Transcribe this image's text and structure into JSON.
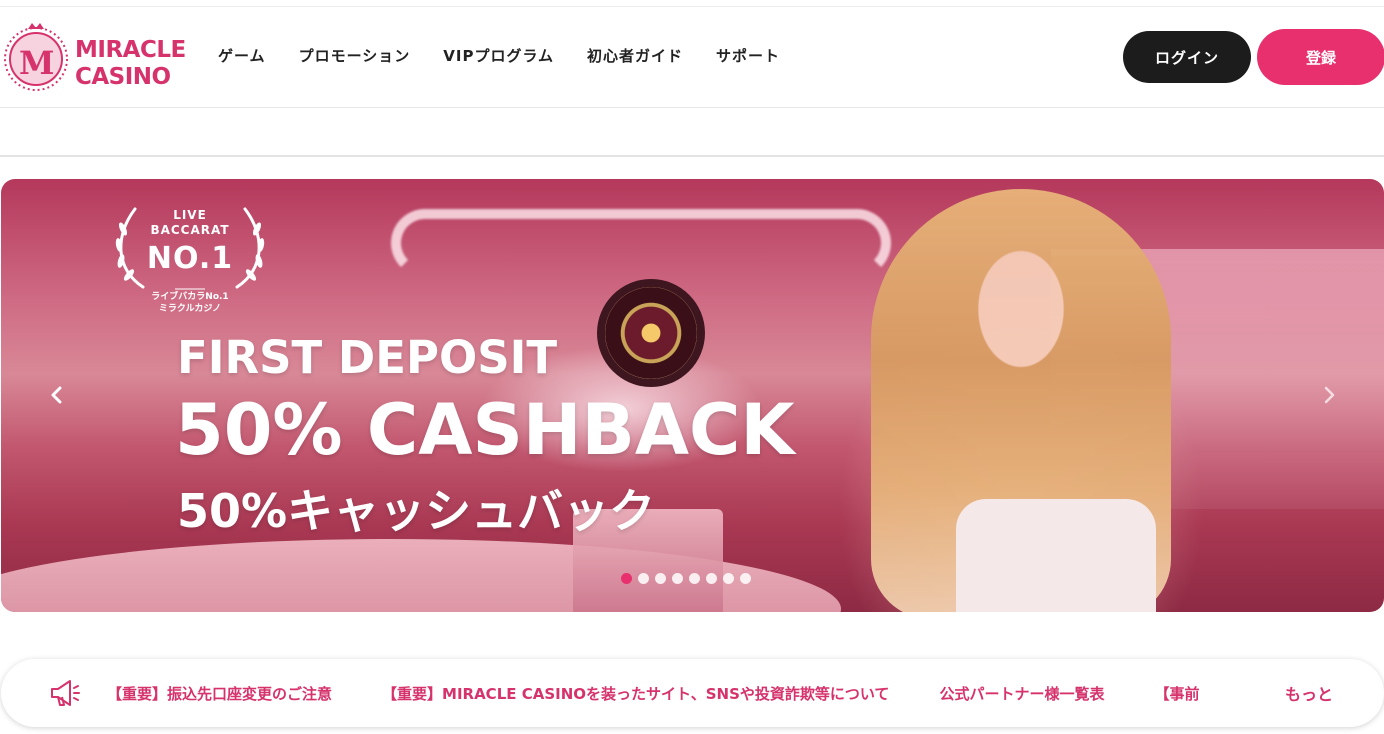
{
  "brand": {
    "logo_letter": "M",
    "logo_line1": "MIRACLE",
    "logo_line2": "CASINO",
    "accent_color": "#e7306d"
  },
  "nav": {
    "items": [
      "ゲーム",
      "プロモーション",
      "VIPプログラム",
      "初心者ガイド",
      "サポート"
    ]
  },
  "auth": {
    "login_label": "ログイン",
    "register_label": "登録"
  },
  "banner": {
    "badge_line1": "LIVE",
    "badge_line2": "BACCARAT",
    "badge_rank": "NO.1",
    "badge_jp1": "ライブバカラNo.1",
    "badge_jp2": "ミラクルカジノ",
    "line1": "FIRST DEPOSIT",
    "line2": "50% CASHBACK",
    "line3": "50%キャッシュバック",
    "prev_icon": "chevron-left-icon",
    "next_icon": "chevron-right-icon",
    "slide_count": 8,
    "active_slide": 1
  },
  "notices": {
    "icon": "megaphone-icon",
    "items": [
      "【重要】振込先口座変更のご注意",
      "【重要】MIRACLE CASINOを装ったサイト、SNSや投資詐欺等について",
      "公式パートナー様一覧表",
      "【事前"
    ],
    "more_label": "もっと"
  }
}
